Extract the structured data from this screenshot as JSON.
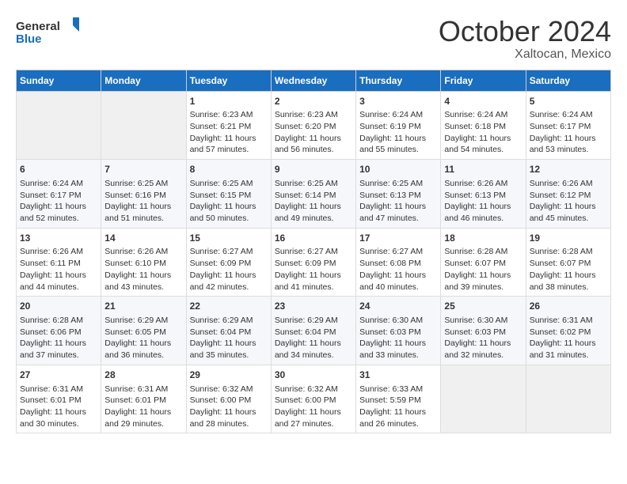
{
  "header": {
    "logo_line1": "General",
    "logo_line2": "Blue",
    "month": "October 2024",
    "location": "Xaltocan, Mexico"
  },
  "days_of_week": [
    "Sunday",
    "Monday",
    "Tuesday",
    "Wednesday",
    "Thursday",
    "Friday",
    "Saturday"
  ],
  "weeks": [
    [
      {
        "day": "",
        "sunrise": "",
        "sunset": "",
        "daylight": ""
      },
      {
        "day": "",
        "sunrise": "",
        "sunset": "",
        "daylight": ""
      },
      {
        "day": "1",
        "sunrise": "Sunrise: 6:23 AM",
        "sunset": "Sunset: 6:21 PM",
        "daylight": "Daylight: 11 hours and 57 minutes."
      },
      {
        "day": "2",
        "sunrise": "Sunrise: 6:23 AM",
        "sunset": "Sunset: 6:20 PM",
        "daylight": "Daylight: 11 hours and 56 minutes."
      },
      {
        "day": "3",
        "sunrise": "Sunrise: 6:24 AM",
        "sunset": "Sunset: 6:19 PM",
        "daylight": "Daylight: 11 hours and 55 minutes."
      },
      {
        "day": "4",
        "sunrise": "Sunrise: 6:24 AM",
        "sunset": "Sunset: 6:18 PM",
        "daylight": "Daylight: 11 hours and 54 minutes."
      },
      {
        "day": "5",
        "sunrise": "Sunrise: 6:24 AM",
        "sunset": "Sunset: 6:17 PM",
        "daylight": "Daylight: 11 hours and 53 minutes."
      }
    ],
    [
      {
        "day": "6",
        "sunrise": "Sunrise: 6:24 AM",
        "sunset": "Sunset: 6:17 PM",
        "daylight": "Daylight: 11 hours and 52 minutes."
      },
      {
        "day": "7",
        "sunrise": "Sunrise: 6:25 AM",
        "sunset": "Sunset: 6:16 PM",
        "daylight": "Daylight: 11 hours and 51 minutes."
      },
      {
        "day": "8",
        "sunrise": "Sunrise: 6:25 AM",
        "sunset": "Sunset: 6:15 PM",
        "daylight": "Daylight: 11 hours and 50 minutes."
      },
      {
        "day": "9",
        "sunrise": "Sunrise: 6:25 AM",
        "sunset": "Sunset: 6:14 PM",
        "daylight": "Daylight: 11 hours and 49 minutes."
      },
      {
        "day": "10",
        "sunrise": "Sunrise: 6:25 AM",
        "sunset": "Sunset: 6:13 PM",
        "daylight": "Daylight: 11 hours and 47 minutes."
      },
      {
        "day": "11",
        "sunrise": "Sunrise: 6:26 AM",
        "sunset": "Sunset: 6:13 PM",
        "daylight": "Daylight: 11 hours and 46 minutes."
      },
      {
        "day": "12",
        "sunrise": "Sunrise: 6:26 AM",
        "sunset": "Sunset: 6:12 PM",
        "daylight": "Daylight: 11 hours and 45 minutes."
      }
    ],
    [
      {
        "day": "13",
        "sunrise": "Sunrise: 6:26 AM",
        "sunset": "Sunset: 6:11 PM",
        "daylight": "Daylight: 11 hours and 44 minutes."
      },
      {
        "day": "14",
        "sunrise": "Sunrise: 6:26 AM",
        "sunset": "Sunset: 6:10 PM",
        "daylight": "Daylight: 11 hours and 43 minutes."
      },
      {
        "day": "15",
        "sunrise": "Sunrise: 6:27 AM",
        "sunset": "Sunset: 6:09 PM",
        "daylight": "Daylight: 11 hours and 42 minutes."
      },
      {
        "day": "16",
        "sunrise": "Sunrise: 6:27 AM",
        "sunset": "Sunset: 6:09 PM",
        "daylight": "Daylight: 11 hours and 41 minutes."
      },
      {
        "day": "17",
        "sunrise": "Sunrise: 6:27 AM",
        "sunset": "Sunset: 6:08 PM",
        "daylight": "Daylight: 11 hours and 40 minutes."
      },
      {
        "day": "18",
        "sunrise": "Sunrise: 6:28 AM",
        "sunset": "Sunset: 6:07 PM",
        "daylight": "Daylight: 11 hours and 39 minutes."
      },
      {
        "day": "19",
        "sunrise": "Sunrise: 6:28 AM",
        "sunset": "Sunset: 6:07 PM",
        "daylight": "Daylight: 11 hours and 38 minutes."
      }
    ],
    [
      {
        "day": "20",
        "sunrise": "Sunrise: 6:28 AM",
        "sunset": "Sunset: 6:06 PM",
        "daylight": "Daylight: 11 hours and 37 minutes."
      },
      {
        "day": "21",
        "sunrise": "Sunrise: 6:29 AM",
        "sunset": "Sunset: 6:05 PM",
        "daylight": "Daylight: 11 hours and 36 minutes."
      },
      {
        "day": "22",
        "sunrise": "Sunrise: 6:29 AM",
        "sunset": "Sunset: 6:04 PM",
        "daylight": "Daylight: 11 hours and 35 minutes."
      },
      {
        "day": "23",
        "sunrise": "Sunrise: 6:29 AM",
        "sunset": "Sunset: 6:04 PM",
        "daylight": "Daylight: 11 hours and 34 minutes."
      },
      {
        "day": "24",
        "sunrise": "Sunrise: 6:30 AM",
        "sunset": "Sunset: 6:03 PM",
        "daylight": "Daylight: 11 hours and 33 minutes."
      },
      {
        "day": "25",
        "sunrise": "Sunrise: 6:30 AM",
        "sunset": "Sunset: 6:03 PM",
        "daylight": "Daylight: 11 hours and 32 minutes."
      },
      {
        "day": "26",
        "sunrise": "Sunrise: 6:31 AM",
        "sunset": "Sunset: 6:02 PM",
        "daylight": "Daylight: 11 hours and 31 minutes."
      }
    ],
    [
      {
        "day": "27",
        "sunrise": "Sunrise: 6:31 AM",
        "sunset": "Sunset: 6:01 PM",
        "daylight": "Daylight: 11 hours and 30 minutes."
      },
      {
        "day": "28",
        "sunrise": "Sunrise: 6:31 AM",
        "sunset": "Sunset: 6:01 PM",
        "daylight": "Daylight: 11 hours and 29 minutes."
      },
      {
        "day": "29",
        "sunrise": "Sunrise: 6:32 AM",
        "sunset": "Sunset: 6:00 PM",
        "daylight": "Daylight: 11 hours and 28 minutes."
      },
      {
        "day": "30",
        "sunrise": "Sunrise: 6:32 AM",
        "sunset": "Sunset: 6:00 PM",
        "daylight": "Daylight: 11 hours and 27 minutes."
      },
      {
        "day": "31",
        "sunrise": "Sunrise: 6:33 AM",
        "sunset": "Sunset: 5:59 PM",
        "daylight": "Daylight: 11 hours and 26 minutes."
      },
      {
        "day": "",
        "sunrise": "",
        "sunset": "",
        "daylight": ""
      },
      {
        "day": "",
        "sunrise": "",
        "sunset": "",
        "daylight": ""
      }
    ]
  ]
}
